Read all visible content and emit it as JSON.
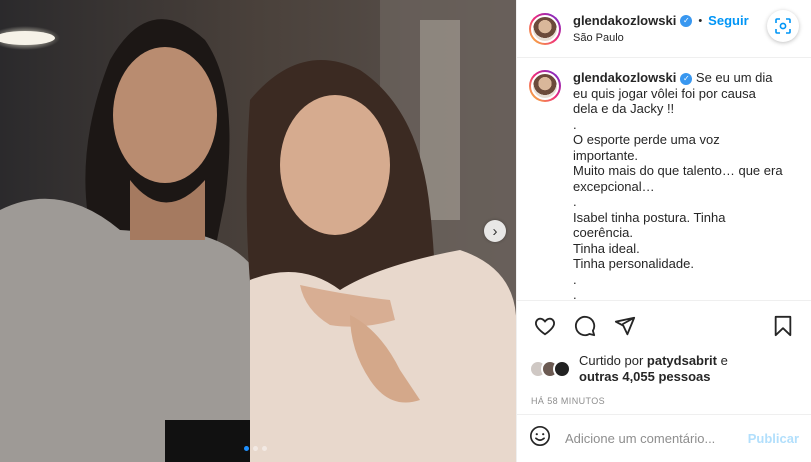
{
  "post": {
    "image_alt_icon": "photo-of-two-women",
    "carousel_next_icon": "chevron-right-icon",
    "carousel_dots": 3,
    "carousel_active_index": 0
  },
  "header": {
    "username": "glendakozlowski",
    "verified_icon": "verified-badge-icon",
    "separator": "•",
    "follow_label": "Seguir",
    "location": "São Paulo",
    "lens_icon": "visual-search-icon"
  },
  "caption": {
    "username": "glendakozlowski",
    "text": " Se eu um dia eu quis jogar vôlei foi por causa dela e da Jacky !!\n.\nO esporte perde uma voz importante.\nMuito mais do que talento… que era excepcional…\n.\nIsabel tinha postura. Tinha coerência.\nTinha ideal.\nTinha personalidade.\n.\n."
  },
  "actions": {
    "like_icon": "heart-icon",
    "comment_icon": "comment-icon",
    "share_icon": "paper-plane-icon",
    "save_icon": "bookmark-icon"
  },
  "likes": {
    "prefix": "Curtido por ",
    "user": "patydsabrit",
    "middle": " e",
    "others": "outras 4,055 pessoas"
  },
  "timestamp": "HÁ 58 MINUTOS",
  "add_comment": {
    "emoji_icon": "emoji-icon",
    "placeholder": "Adicione um comentário...",
    "post_label": "Publicar"
  },
  "colors": {
    "accent": "#0095f6",
    "publish_disabled": "#b2dffc",
    "muted": "#8e8e8e"
  }
}
